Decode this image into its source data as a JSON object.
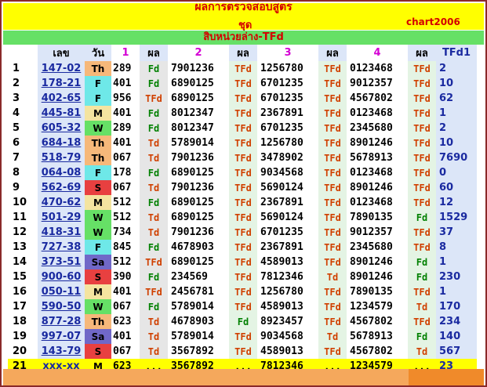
{
  "header": {
    "title": "ผลการตรวจสอบสูตร",
    "set_label": "ชุด",
    "chart_name": "chart2006",
    "subtitle": "สิบหน่วยล่าง-TFd"
  },
  "columns": {
    "code": "เลข",
    "day": "วัน",
    "c1": "1",
    "r1": "ผล",
    "c2": "2",
    "r2": "ผล",
    "c3": "3",
    "r3": "ผล",
    "c4": "4",
    "r4": "ผล",
    "tfd1": "TFd1"
  },
  "colors": {
    "Fd": "#008000",
    "TFd": "#d04000",
    "Td": "#d04000",
    "day_Th": "#f6b87a",
    "day_F": "#6ee8e8",
    "day_M": "#f4e4a0",
    "day_W": "#66e066",
    "day_S": "#e84040",
    "day_Sa": "#7068c8"
  },
  "rows": [
    {
      "idx": "1",
      "code": "147-02",
      "day": "Th",
      "n1": "289",
      "r1": "Fd",
      "n2": "7901236",
      "r2": "TFd",
      "n3": "1256780",
      "r3": "TFd",
      "n4": "0123468",
      "r4": "TFd",
      "tfd1": "2"
    },
    {
      "idx": "2",
      "code": "178-21",
      "day": "F",
      "n1": "401",
      "r1": "Fd",
      "n2": "6890125",
      "r2": "TFd",
      "n3": "6701235",
      "r3": "TFd",
      "n4": "9012357",
      "r4": "TFd",
      "tfd1": "10"
    },
    {
      "idx": "3",
      "code": "402-65",
      "day": "F",
      "n1": "956",
      "r1": "TFd",
      "n2": "6890125",
      "r2": "TFd",
      "n3": "6701235",
      "r3": "TFd",
      "n4": "4567802",
      "r4": "TFd",
      "tfd1": "62"
    },
    {
      "idx": "4",
      "code": "445-81",
      "day": "M",
      "n1": "401",
      "r1": "Fd",
      "n2": "8012347",
      "r2": "TFd",
      "n3": "2367891",
      "r3": "TFd",
      "n4": "0123468",
      "r4": "TFd",
      "tfd1": "1"
    },
    {
      "idx": "5",
      "code": "605-32",
      "day": "W",
      "n1": "289",
      "r1": "Fd",
      "n2": "8012347",
      "r2": "TFd",
      "n3": "6701235",
      "r3": "TFd",
      "n4": "2345680",
      "r4": "TFd",
      "tfd1": "2"
    },
    {
      "idx": "6",
      "code": "684-18",
      "day": "Th",
      "n1": "401",
      "r1": "Td",
      "n2": "5789014",
      "r2": "TFd",
      "n3": "1256780",
      "r3": "TFd",
      "n4": "8901246",
      "r4": "TFd",
      "tfd1": "10"
    },
    {
      "idx": "7",
      "code": "518-79",
      "day": "Th",
      "n1": "067",
      "r1": "Td",
      "n2": "7901236",
      "r2": "TFd",
      "n3": "3478902",
      "r3": "TFd",
      "n4": "5678913",
      "r4": "TFd",
      "tfd1": "7690"
    },
    {
      "idx": "8",
      "code": "064-08",
      "day": "F",
      "n1": "178",
      "r1": "Fd",
      "n2": "6890125",
      "r2": "TFd",
      "n3": "9034568",
      "r3": "TFd",
      "n4": "0123468",
      "r4": "TFd",
      "tfd1": "0"
    },
    {
      "idx": "9",
      "code": "562-69",
      "day": "S",
      "n1": "067",
      "r1": "Td",
      "n2": "7901236",
      "r2": "TFd",
      "n3": "5690124",
      "r3": "TFd",
      "n4": "8901246",
      "r4": "TFd",
      "tfd1": "60"
    },
    {
      "idx": "10",
      "code": "470-62",
      "day": "M",
      "n1": "512",
      "r1": "Fd",
      "n2": "6890125",
      "r2": "TFd",
      "n3": "2367891",
      "r3": "TFd",
      "n4": "0123468",
      "r4": "TFd",
      "tfd1": "12"
    },
    {
      "idx": "11",
      "code": "501-29",
      "day": "W",
      "n1": "512",
      "r1": "Td",
      "n2": "6890125",
      "r2": "TFd",
      "n3": "5690124",
      "r3": "TFd",
      "n4": "7890135",
      "r4": "Fd",
      "tfd1": "1529"
    },
    {
      "idx": "12",
      "code": "418-31",
      "day": "W",
      "n1": "734",
      "r1": "Td",
      "n2": "7901236",
      "r2": "TFd",
      "n3": "6701235",
      "r3": "TFd",
      "n4": "9012357",
      "r4": "TFd",
      "tfd1": "37"
    },
    {
      "idx": "13",
      "code": "727-38",
      "day": "F",
      "n1": "845",
      "r1": "Fd",
      "n2": "4678903",
      "r2": "TFd",
      "n3": "2367891",
      "r3": "TFd",
      "n4": "2345680",
      "r4": "TFd",
      "tfd1": "8"
    },
    {
      "idx": "14",
      "code": "373-51",
      "day": "Sa",
      "n1": "512",
      "r1": "TFd",
      "n2": "6890125",
      "r2": "TFd",
      "n3": "4589013",
      "r3": "TFd",
      "n4": "8901246",
      "r4": "Fd",
      "tfd1": "1"
    },
    {
      "idx": "15",
      "code": "900-60",
      "day": "S",
      "n1": "390",
      "r1": "Fd",
      "n2": "234569",
      "r2": "TFd",
      "n3": "7812346",
      "r3": "Td",
      "n4": "8901246",
      "r4": "Fd",
      "tfd1": "230"
    },
    {
      "idx": "16",
      "code": "050-11",
      "day": "M",
      "n1": "401",
      "r1": "TFd",
      "n2": "2456781",
      "r2": "TFd",
      "n3": "1256780",
      "r3": "TFd",
      "n4": "7890135",
      "r4": "TFd",
      "tfd1": "1"
    },
    {
      "idx": "17",
      "code": "590-50",
      "day": "W",
      "n1": "067",
      "r1": "Fd",
      "n2": "5789014",
      "r2": "TFd",
      "n3": "4589013",
      "r3": "TFd",
      "n4": "1234579",
      "r4": "Td",
      "tfd1": "170"
    },
    {
      "idx": "18",
      "code": "877-28",
      "day": "Th",
      "n1": "623",
      "r1": "Td",
      "n2": "4678903",
      "r2": "Fd",
      "n3": "8923457",
      "r3": "TFd",
      "n4": "4567802",
      "r4": "TFd",
      "tfd1": "234"
    },
    {
      "idx": "19",
      "code": "997-07",
      "day": "Sa",
      "n1": "401",
      "r1": "Td",
      "n2": "5789014",
      "r2": "TFd",
      "n3": "9034568",
      "r3": "Td",
      "n4": "5678913",
      "r4": "Fd",
      "tfd1": "140"
    },
    {
      "idx": "20",
      "code": "143-79",
      "day": "S",
      "n1": "067",
      "r1": "Td",
      "n2": "3567892",
      "r2": "TFd",
      "n3": "4589013",
      "r3": "TFd",
      "n4": "4567802",
      "r4": "Td",
      "tfd1": "567"
    }
  ],
  "last_row": {
    "idx": "21",
    "code": "xxx-xx",
    "day": "M",
    "n1": "623",
    "r1": "...",
    "n2": "3567892",
    "r2": "...",
    "n3": "7812346",
    "r3": "...",
    "n4": "1234579",
    "r4": "...",
    "tfd1": "23"
  }
}
